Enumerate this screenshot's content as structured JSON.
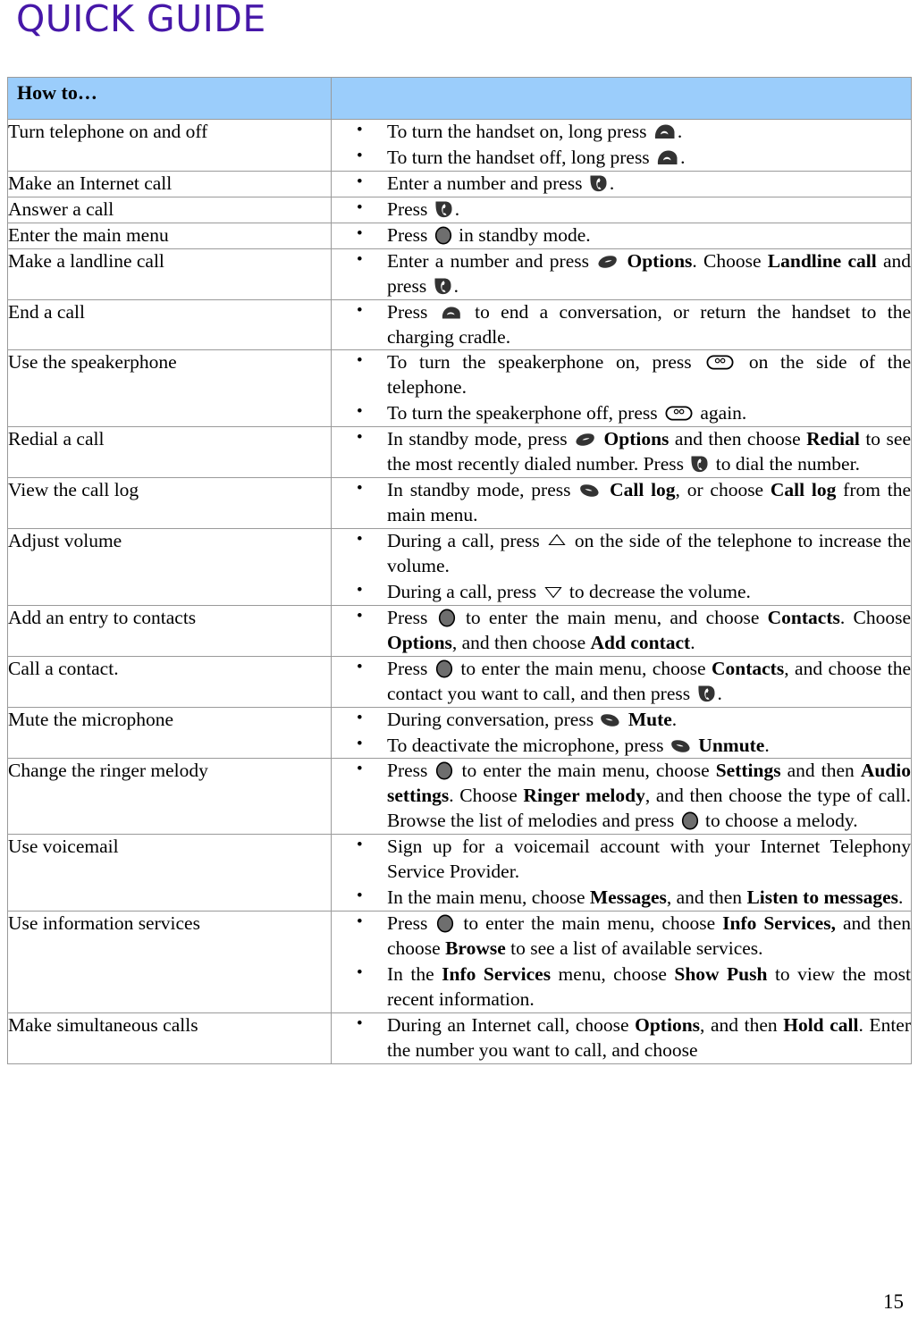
{
  "document": {
    "title": "QUICK GUIDE",
    "page_number": "15",
    "title_color": "#4617A8",
    "header_fill_color": "#9BCDFB",
    "border_color": "#9A9A9A",
    "ok_key_color": "#6E6E6E"
  },
  "table": {
    "headers": {
      "left": "How to…",
      "right": ""
    },
    "icon_names": {
      "endcall": "end-call-key-icon",
      "call": "call-key-icon",
      "softkey_left": "left-softkey-icon",
      "softkey_right": "right-softkey-icon",
      "ok": "ok-key-icon",
      "speaker": "speakerphone-key-icon",
      "volume_up": "volume-up-key-icon",
      "volume_down": "volume-down-key-icon"
    },
    "rows": [
      {
        "task": "Turn telephone on and off",
        "steps": [
          "To turn the handset on, long press  [end-call-key-icon] .",
          "To turn the handset off, long press  [end-call-key-icon] ."
        ]
      },
      {
        "task": "Make an Internet call",
        "steps": [
          "Enter a number and press  [call-key-icon] ."
        ]
      },
      {
        "task": "Answer a call",
        "steps": [
          "Press  [call-key-icon] ."
        ]
      },
      {
        "task": "Enter the main menu",
        "steps": [
          "Press  [ok-key-icon]  in standby mode."
        ]
      },
      {
        "task": "Make a landline call",
        "steps": [
          "Enter a number and press [left-softkey-icon] Options. Choose Landline call and press [call-key-icon]."
        ]
      },
      {
        "task": "End a call",
        "steps": [
          "Press [end-call-key-icon] to end a conversation, or return the handset to the charging cradle."
        ]
      },
      {
        "task": "Use the speakerphone",
        "steps": [
          "To turn the speakerphone on, press [speakerphone-key-icon] on the side of the telephone.",
          "To turn the speakerphone off, press [speakerphone-key-icon] again."
        ]
      },
      {
        "task": "Redial a call",
        "steps": [
          "In standby mode, press [left-softkey-icon] Options and then choose Redial to see the most recently dialed number. Press [call-key-icon] to dial the number."
        ]
      },
      {
        "task": "View the call log",
        "steps": [
          "In standby mode, press [right-softkey-icon] Call log, or choose Call log from the main menu."
        ]
      },
      {
        "task": "Adjust volume",
        "steps": [
          "During a call, press [volume-up-key-icon] on the side of the telephone to increase the volume.",
          "During a call, press [volume-down-key-icon] to decrease the volume."
        ]
      },
      {
        "task": "Add an entry to contacts",
        "steps": [
          "Press [ok-key-icon] to enter the main menu, and choose Contacts. Choose Options, and then choose Add contact."
        ]
      },
      {
        "task": "Call a contact.",
        "steps": [
          "Press [ok-key-icon] to enter the main menu, choose Contacts, and choose the contact you want to call, and then press [call-key-icon]."
        ]
      },
      {
        "task": "Mute the microphone",
        "steps": [
          "During conversation, press [right-softkey-icon] Mute.",
          "To deactivate the microphone, press [right-softkey-icon] Unmute."
        ]
      },
      {
        "task": "Change the ringer melody",
        "steps": [
          "Press [ok-key-icon] to enter the main menu, choose Settings and then Audio settings. Choose Ringer melody, and then choose the type of call. Browse the list of melodies and press [ok-key-icon] to choose a melody."
        ]
      },
      {
        "task": "Use voicemail",
        "steps": [
          "Sign up for a voicemail account with your Internet Telephony Service Provider.",
          "In the main menu, choose Messages, and then Listen to messages."
        ]
      },
      {
        "task": "Use information services",
        "steps": [
          "Press [ok-key-icon] to enter the main menu, choose Info Services, and then choose Browse to see a list of available services.",
          "In the Info Services menu, choose Show Push to view the most recent information."
        ]
      },
      {
        "task": "Make simultaneous calls",
        "steps": [
          "During an Internet call, choose Options, and then Hold call. Enter the number you want to call, and choose"
        ]
      }
    ]
  }
}
